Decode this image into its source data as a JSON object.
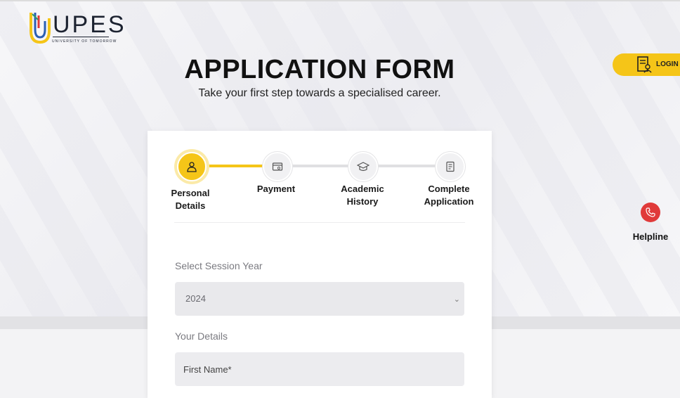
{
  "brand": {
    "name": "UPES",
    "tagline": "UNIVERSITY OF TOMORROW",
    "colors": {
      "yellow": "#f5c518",
      "blue": "#2c5fb3",
      "red": "#e03a3a",
      "dark": "#1c2230"
    }
  },
  "header": {
    "title": "APPLICATION FORM",
    "subtitle": "Take your first step towards a specialised career."
  },
  "login": {
    "label": "LOGIN",
    "icon": "document-user-icon"
  },
  "helpline": {
    "label": "Helpline",
    "icon": "phone-icon"
  },
  "steps": [
    {
      "line1": "Personal",
      "line2": "Details",
      "icon": "user-icon",
      "active": true
    },
    {
      "line1": "Payment",
      "line2": "",
      "icon": "payment-icon",
      "active": false
    },
    {
      "line1": "Academic",
      "line2": "History",
      "icon": "graduation-cap-icon",
      "active": false
    },
    {
      "line1": "Complete",
      "line2": "Application",
      "icon": "checklist-icon",
      "active": false
    }
  ],
  "form": {
    "session_label": "Select Session Year",
    "session_value": "2024",
    "details_label": "Your Details",
    "first_name_placeholder": "First Name*"
  }
}
